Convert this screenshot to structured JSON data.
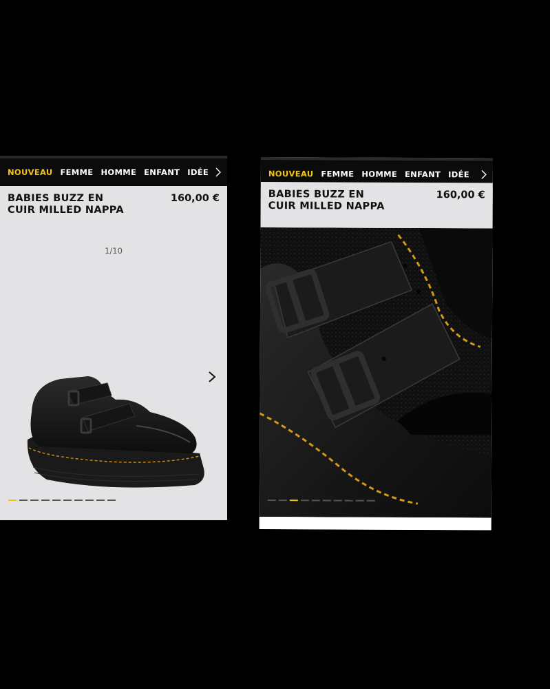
{
  "nav": {
    "items": [
      "NOUVEAU",
      "FEMME",
      "HOMME",
      "ENFANT",
      "IDÉE"
    ],
    "active_index": 0,
    "more_icon": "chevron-right-icon"
  },
  "product": {
    "title": "BABIES BUZZ EN CUIR MILLED NAPPA",
    "price": "160,00 €"
  },
  "left_screen": {
    "image_counter": "1/10",
    "total_images": 10,
    "active_image": 1,
    "next_icon": "chevron-right-icon"
  },
  "right_screen": {
    "total_images": 10,
    "active_image": 3
  },
  "colors": {
    "accent": "#f2c21a",
    "nav_bg": "#0b0b0b",
    "panel_bg": "#e3e3e5",
    "page_bg": "#000000"
  }
}
